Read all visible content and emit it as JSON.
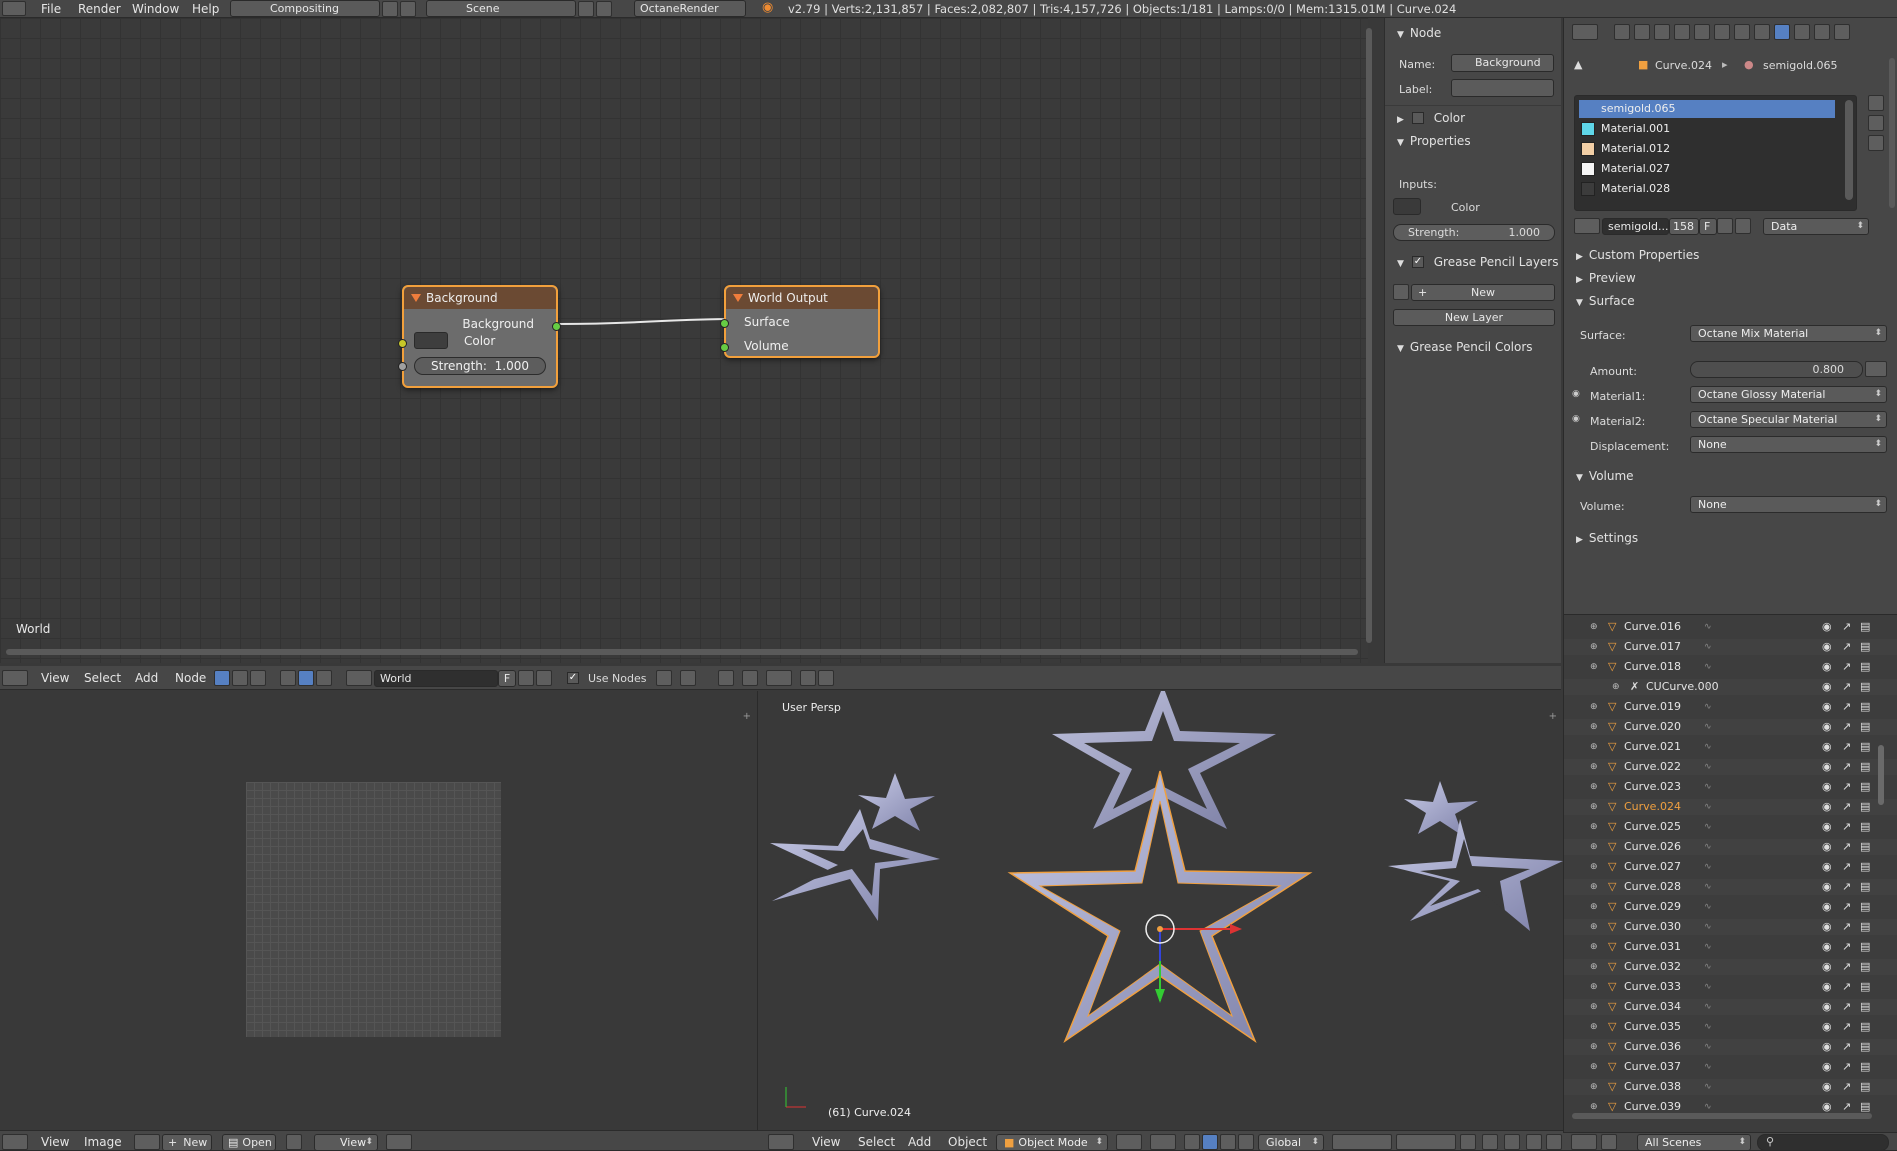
{
  "top_bar": {
    "menus": [
      "File",
      "Render",
      "Window",
      "Help"
    ],
    "layout": "Compositing",
    "scene": "Scene",
    "engine": "OctaneRender",
    "stats": "v2.79 | Verts:2,131,857 | Faces:2,082,807 | Tris:4,157,726 | Objects:1/181 | Lamps:0/0 | Mem:1315.01M | Curve.024"
  },
  "node_editor": {
    "corner_label": "World",
    "nodes": {
      "background": {
        "title": "Background",
        "output": "Background",
        "color_label": "Color",
        "strength_label": "Strength:",
        "strength_value": "1.000"
      },
      "world_output": {
        "title": "World Output",
        "surface": "Surface",
        "volume": "Volume"
      }
    },
    "header": {
      "menus": [
        "View",
        "Select",
        "Add",
        "Node"
      ],
      "world_name": "World",
      "fake_user": "F",
      "use_nodes_label": "Use Nodes"
    }
  },
  "node_sidebar": {
    "node_panel": "Node",
    "name_label": "Name:",
    "name_value": "Background",
    "label_label": "Label:",
    "label_value": "",
    "color_panel": "Color",
    "properties_panel": "Properties",
    "inputs_label": "Inputs:",
    "input_color_label": "Color",
    "strength_label": "Strength:",
    "strength_value": "1.000",
    "gp_layers_panel": "Grease Pencil Layers",
    "new_btn": "New",
    "new_layer_btn": "New Layer",
    "gp_colors_panel": "Grease Pencil Colors"
  },
  "properties": {
    "breadcrumb": [
      "Curve.024",
      "semigold.065"
    ],
    "materials": [
      {
        "name": "semigold.065",
        "color": "#3b6fc4",
        "selected": true
      },
      {
        "name": "Material.001",
        "color": "#5fd6e8",
        "selected": false
      },
      {
        "name": "Material.012",
        "color": "#f2cfa6",
        "selected": false
      },
      {
        "name": "Material.027",
        "color": "#f5f5f5",
        "selected": false
      },
      {
        "name": "Material.028",
        "color": "#3c3c3c",
        "selected": false
      }
    ],
    "mat_field": "semigold....",
    "mat_users": "158",
    "fake_user": "F",
    "link_dropdown": "Data",
    "panels": {
      "custom_props": "Custom Properties",
      "preview": "Preview",
      "surface": "Surface",
      "volume": "Volume",
      "settings": "Settings"
    },
    "surface_label": "Surface:",
    "surface_value": "Octane Mix Material",
    "amount_label": "Amount:",
    "amount_value": "0.800",
    "mat1_label": "Material1:",
    "mat1_value": "Octane Glossy Material",
    "mat2_label": "Material2:",
    "mat2_value": "Octane Specular Material",
    "disp_label": "Displacement:",
    "disp_value": "None",
    "volume_label": "Volume:",
    "volume_value": "None"
  },
  "outliner": {
    "rows": [
      {
        "name": "Curve.016",
        "icon": "curve-icon",
        "indent": 0
      },
      {
        "name": "Curve.017",
        "icon": "curve-icon",
        "indent": 0
      },
      {
        "name": "Curve.018",
        "icon": "curve-icon",
        "indent": 0
      },
      {
        "name": "CUCurve.000",
        "icon": "curve-data-icon",
        "indent": 1
      },
      {
        "name": "Curve.019",
        "icon": "curve-icon",
        "indent": 0
      },
      {
        "name": "Curve.020",
        "icon": "curve-icon",
        "indent": 0
      },
      {
        "name": "Curve.021",
        "icon": "curve-icon",
        "indent": 0
      },
      {
        "name": "Curve.022",
        "icon": "curve-icon",
        "indent": 0
      },
      {
        "name": "Curve.023",
        "icon": "curve-icon",
        "indent": 0
      },
      {
        "name": "Curve.024",
        "icon": "curve-icon",
        "indent": 0,
        "active": true
      },
      {
        "name": "Curve.025",
        "icon": "curve-icon",
        "indent": 0
      },
      {
        "name": "Curve.026",
        "icon": "curve-icon",
        "indent": 0
      },
      {
        "name": "Curve.027",
        "icon": "curve-icon",
        "indent": 0
      },
      {
        "name": "Curve.028",
        "icon": "curve-icon",
        "indent": 0
      },
      {
        "name": "Curve.029",
        "icon": "curve-icon",
        "indent": 0
      },
      {
        "name": "Curve.030",
        "icon": "curve-icon",
        "indent": 0
      },
      {
        "name": "Curve.031",
        "icon": "curve-icon",
        "indent": 0
      },
      {
        "name": "Curve.032",
        "icon": "curve-icon",
        "indent": 0
      },
      {
        "name": "Curve.033",
        "icon": "curve-icon",
        "indent": 0
      },
      {
        "name": "Curve.034",
        "icon": "curve-icon",
        "indent": 0
      },
      {
        "name": "Curve.035",
        "icon": "curve-icon",
        "indent": 0
      },
      {
        "name": "Curve.036",
        "icon": "curve-icon",
        "indent": 0
      },
      {
        "name": "Curve.037",
        "icon": "curve-icon",
        "indent": 0
      },
      {
        "name": "Curve.038",
        "icon": "curve-icon",
        "indent": 0
      },
      {
        "name": "Curve.039",
        "icon": "curve-icon",
        "indent": 0
      }
    ],
    "footer_scene": "All Scenes"
  },
  "image_editor": {
    "menus": [
      "View",
      "Image"
    ],
    "new_btn": "New",
    "open_btn": "Open",
    "view_dd": "View"
  },
  "viewport": {
    "label": "User Persp",
    "object_label": "(61) Curve.024",
    "menus": [
      "View",
      "Select",
      "Add",
      "Object"
    ],
    "mode": "Object Mode",
    "orientation": "Global"
  }
}
